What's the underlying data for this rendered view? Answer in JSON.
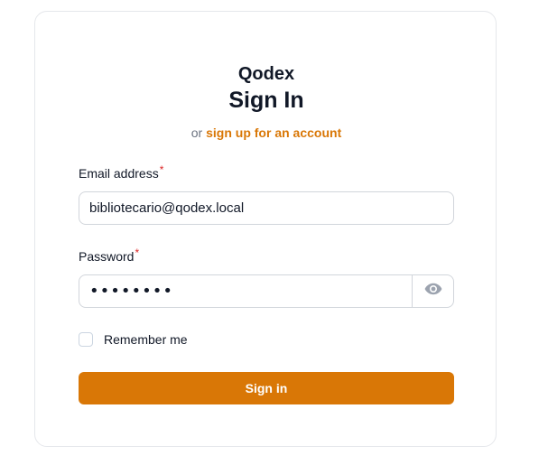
{
  "brand": {
    "name": "Qodex"
  },
  "heading": {
    "title": "Sign In",
    "alt_prefix": "or",
    "signup_link": "sign up for an account"
  },
  "form": {
    "email": {
      "label": "Email address",
      "required_mark": "*",
      "value": "bibliotecario@qodex.local"
    },
    "password": {
      "label": "Password",
      "required_mark": "*",
      "value": "••••••••",
      "toggle_icon": "eye-icon"
    },
    "remember": {
      "label": "Remember me",
      "checked": false
    },
    "submit_label": "Sign in"
  },
  "colors": {
    "accent": "#d97706",
    "required": "#dc2626",
    "border": "#d1d5db"
  }
}
